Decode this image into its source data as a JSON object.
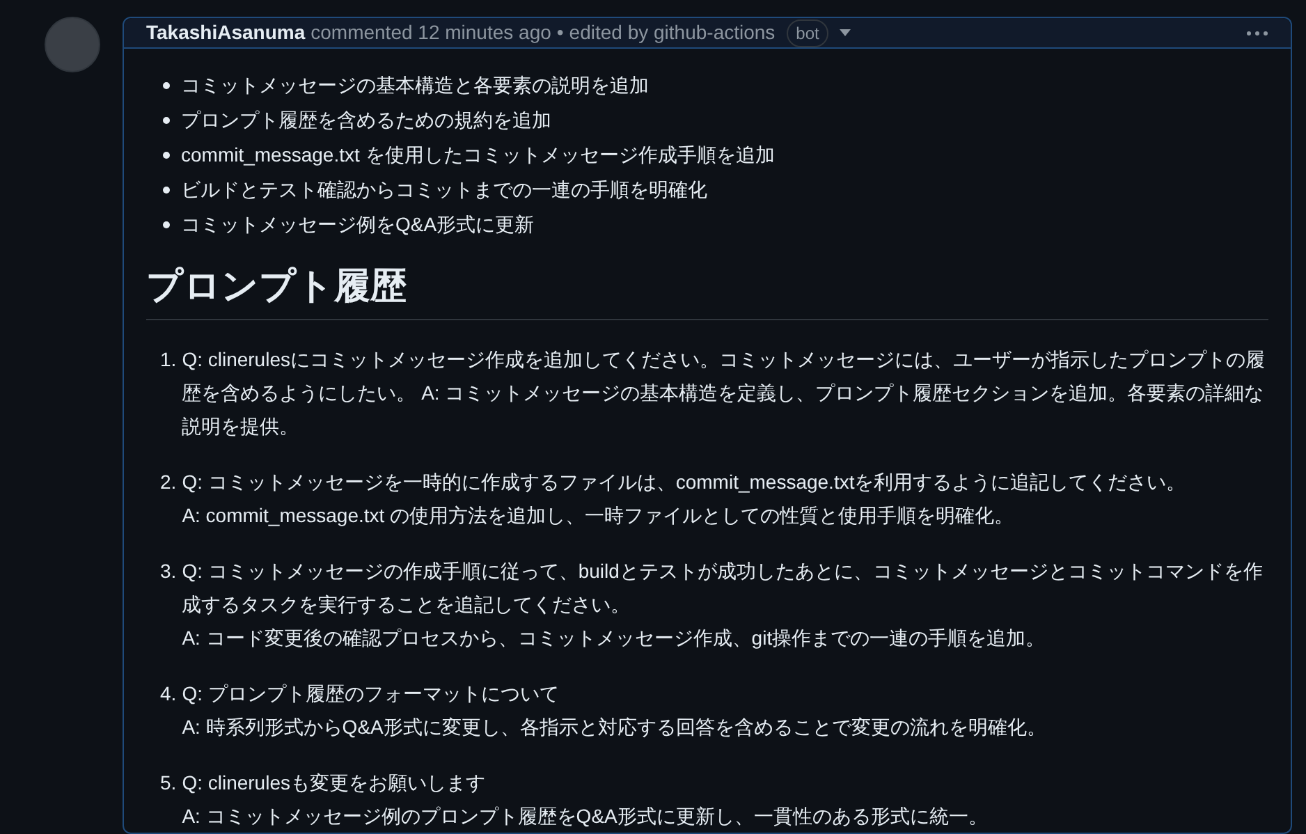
{
  "comment": {
    "author": "TakashiAsanuma",
    "meta": "commented 12 minutes ago",
    "separator": "•",
    "edited": "edited by github-actions",
    "badge": "bot"
  },
  "bullets": [
    "コミットメッセージの基本構造と各要素の説明を追加",
    "プロンプト履歴を含めるための規約を追加",
    "commit_message.txt を使用したコミットメッセージ作成手順を追加",
    "ビルドとテスト確認からコミットまでの一連の手順を明確化",
    "コミットメッセージ例をQ&A形式に更新"
  ],
  "heading": "プロンプト履歴",
  "history": [
    {
      "number": "1.",
      "lines": [
        "Q: clinerulesにコミットメッセージ作成を追加してください。コミットメッセージには、ユーザーが指示したプロンプトの履歴を含めるようにしたい。 A: コミットメッセージの基本構造を定義し、プロンプト履歴セクションを追加。各要素の詳細な説明を提供。"
      ]
    },
    {
      "number": "2.",
      "lines": [
        "Q: コミットメッセージを一時的に作成するファイルは、commit_message.txtを利用するように追記してください。",
        "A: commit_message.txt の使用方法を追加し、一時ファイルとしての性質と使用手順を明確化。"
      ]
    },
    {
      "number": "3.",
      "lines": [
        "Q: コミットメッセージの作成手順に従って、buildとテストが成功したあとに、コミットメッセージとコミットコマンドを作成するタスクを実行することを追記してください。",
        "A: コード変更後の確認プロセスから、コミットメッセージ作成、git操作までの一連の手順を追加。"
      ]
    },
    {
      "number": "4.",
      "lines": [
        "Q: プロンプト履歴のフォーマットについて",
        "A: 時系列形式からQ&A形式に変更し、各指示と対応する回答を含めることで変更の流れを明確化。"
      ]
    },
    {
      "number": "5.",
      "lines": [
        "Q: clinerulesも変更をお願いします",
        "A: コミットメッセージ例のプロンプト履歴をQ&A形式に更新し、一貫性のある形式に統一。"
      ]
    }
  ]
}
